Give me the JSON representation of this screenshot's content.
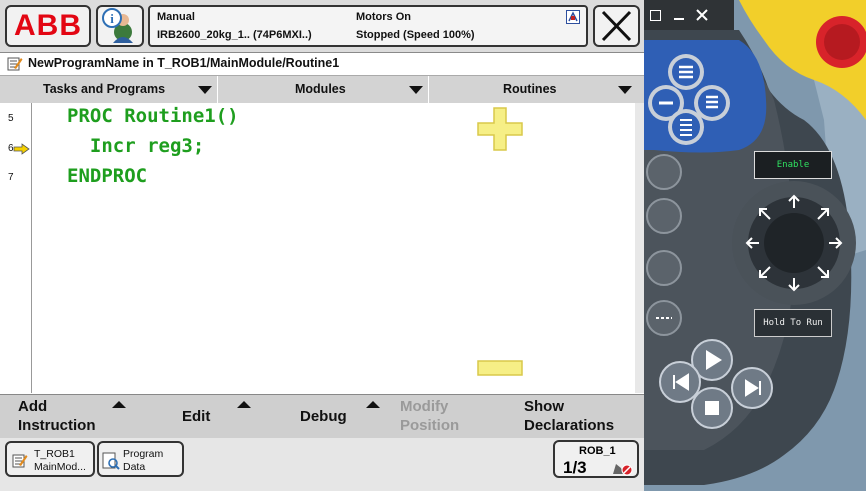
{
  "topbar": {
    "logo_text": "ABB",
    "status": {
      "mode": "Manual",
      "robot": "IRB2600_20kg_1.. (74P6MXI..)",
      "motors": "Motors On",
      "state": "Stopped (Speed 100%)"
    }
  },
  "path": {
    "text": "NewProgramName  in  T_ROB1/MainModule/Routine1"
  },
  "header_tabs": [
    {
      "label": "Tasks and Programs"
    },
    {
      "label": "Modules"
    },
    {
      "label": "Routines"
    }
  ],
  "code": {
    "lines": [
      {
        "num": "5",
        "text": "PROC Routine1()"
      },
      {
        "num": "6",
        "text": "  Incr reg3;"
      },
      {
        "num": "7",
        "text": "ENDPROC"
      }
    ],
    "program_pointer_line": "6"
  },
  "bottom_menu": {
    "add_instruction_1": "Add",
    "add_instruction_2": "Instruction",
    "edit": "Edit",
    "debug": "Debug",
    "modify_position_1": "Modify",
    "modify_position_2": "Position",
    "show_declarations_1": "Show",
    "show_declarations_2": "Declarations"
  },
  "taskbar": {
    "task1_line1": "T_ROB1",
    "task1_line2": "MainMod...",
    "task2_line1": "Program",
    "task2_line2": "Data",
    "rob_label": "ROB_1",
    "rob_fraction": "1/3"
  },
  "pendant": {
    "enable_label": "Enable",
    "hold_to_run_label": "Hold To Run"
  },
  "colors": {
    "code_green": "#1e9e1e",
    "logo_red": "#e30613",
    "pointer_yellow": "#f5d000",
    "zoom_yellow": "#f6ef86",
    "pendant_blue": "#2f5fb5",
    "pendant_gray": "#6f7a86",
    "emergency_red": "#d8232a",
    "enable_yellow": "#f2cf2a"
  }
}
